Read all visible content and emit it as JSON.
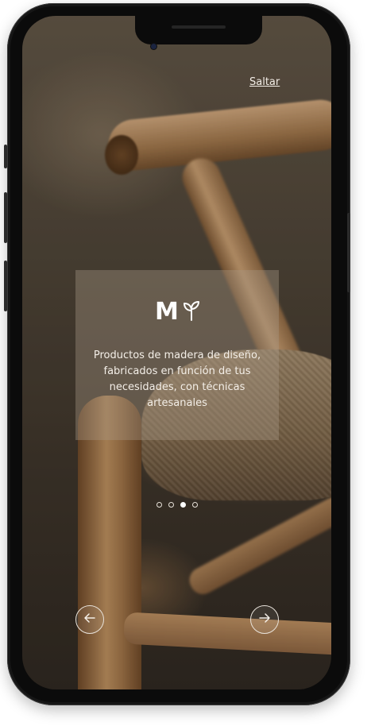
{
  "app": {
    "skip_label": "Saltar",
    "brand_letter": "M",
    "tagline": "Productos de madera de diseño, fabricados en función de tus necesidades, con técnicas artesanales"
  },
  "pagination": {
    "total": 4,
    "current": 3
  },
  "icons": {
    "logo_mark": "sprout-icon",
    "prev": "arrow-left-icon",
    "next": "arrow-right-icon"
  },
  "colors": {
    "text": "#f4efe8",
    "card_overlay": "#a89887"
  }
}
